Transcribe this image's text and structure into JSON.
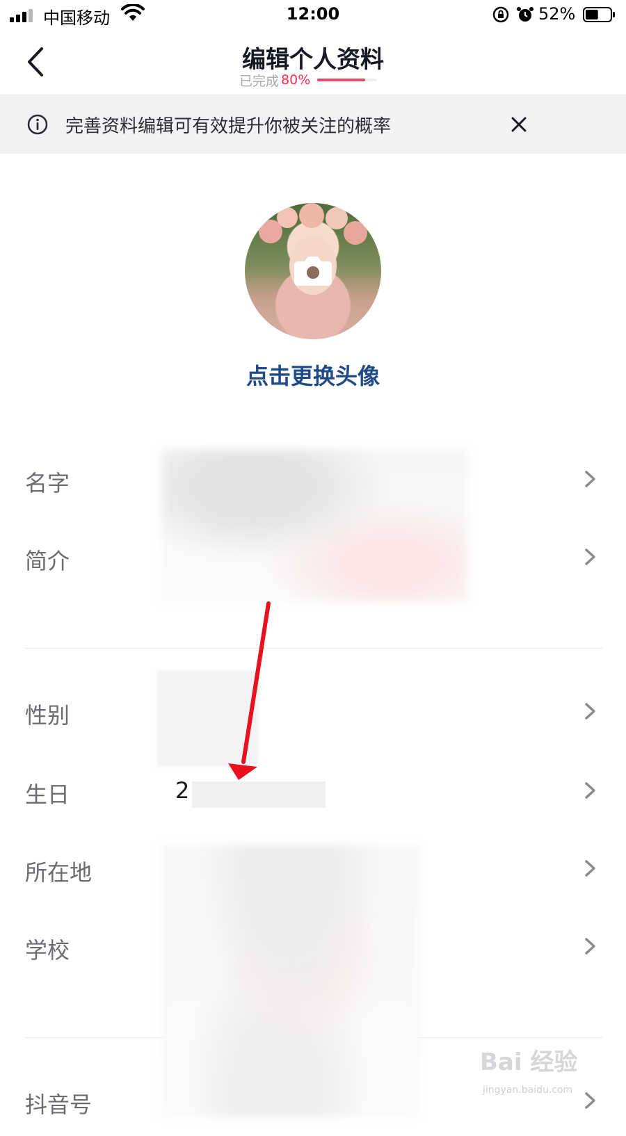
{
  "status_bar": {
    "carrier": "中国移动",
    "time": "12:00",
    "battery": "52%",
    "battery_level": 0.52
  },
  "nav": {
    "title": "编辑个人资料",
    "progress_label": "已完成",
    "progress_value": "80%",
    "progress_fraction": 0.8
  },
  "tip": {
    "text": "完善资料编辑可有效提升你被关注的概率"
  },
  "avatar": {
    "change_label": "点击更换头像"
  },
  "rows": [
    {
      "label": "名字",
      "value": ""
    },
    {
      "label": "简介",
      "value": ""
    },
    {
      "label": "性别",
      "value": ""
    },
    {
      "label": "生日",
      "value": "2"
    },
    {
      "label": "所在地",
      "value": ""
    },
    {
      "label": "学校",
      "value": ""
    },
    {
      "label": "抖音号",
      "value": ""
    }
  ],
  "watermark": {
    "logo_text": "Bai 经验",
    "url": "jingyan.baidu.com"
  },
  "colors": {
    "accent": "#fe2c55",
    "link": "#1e4a86",
    "annotation_arrow": "#e8111e"
  }
}
